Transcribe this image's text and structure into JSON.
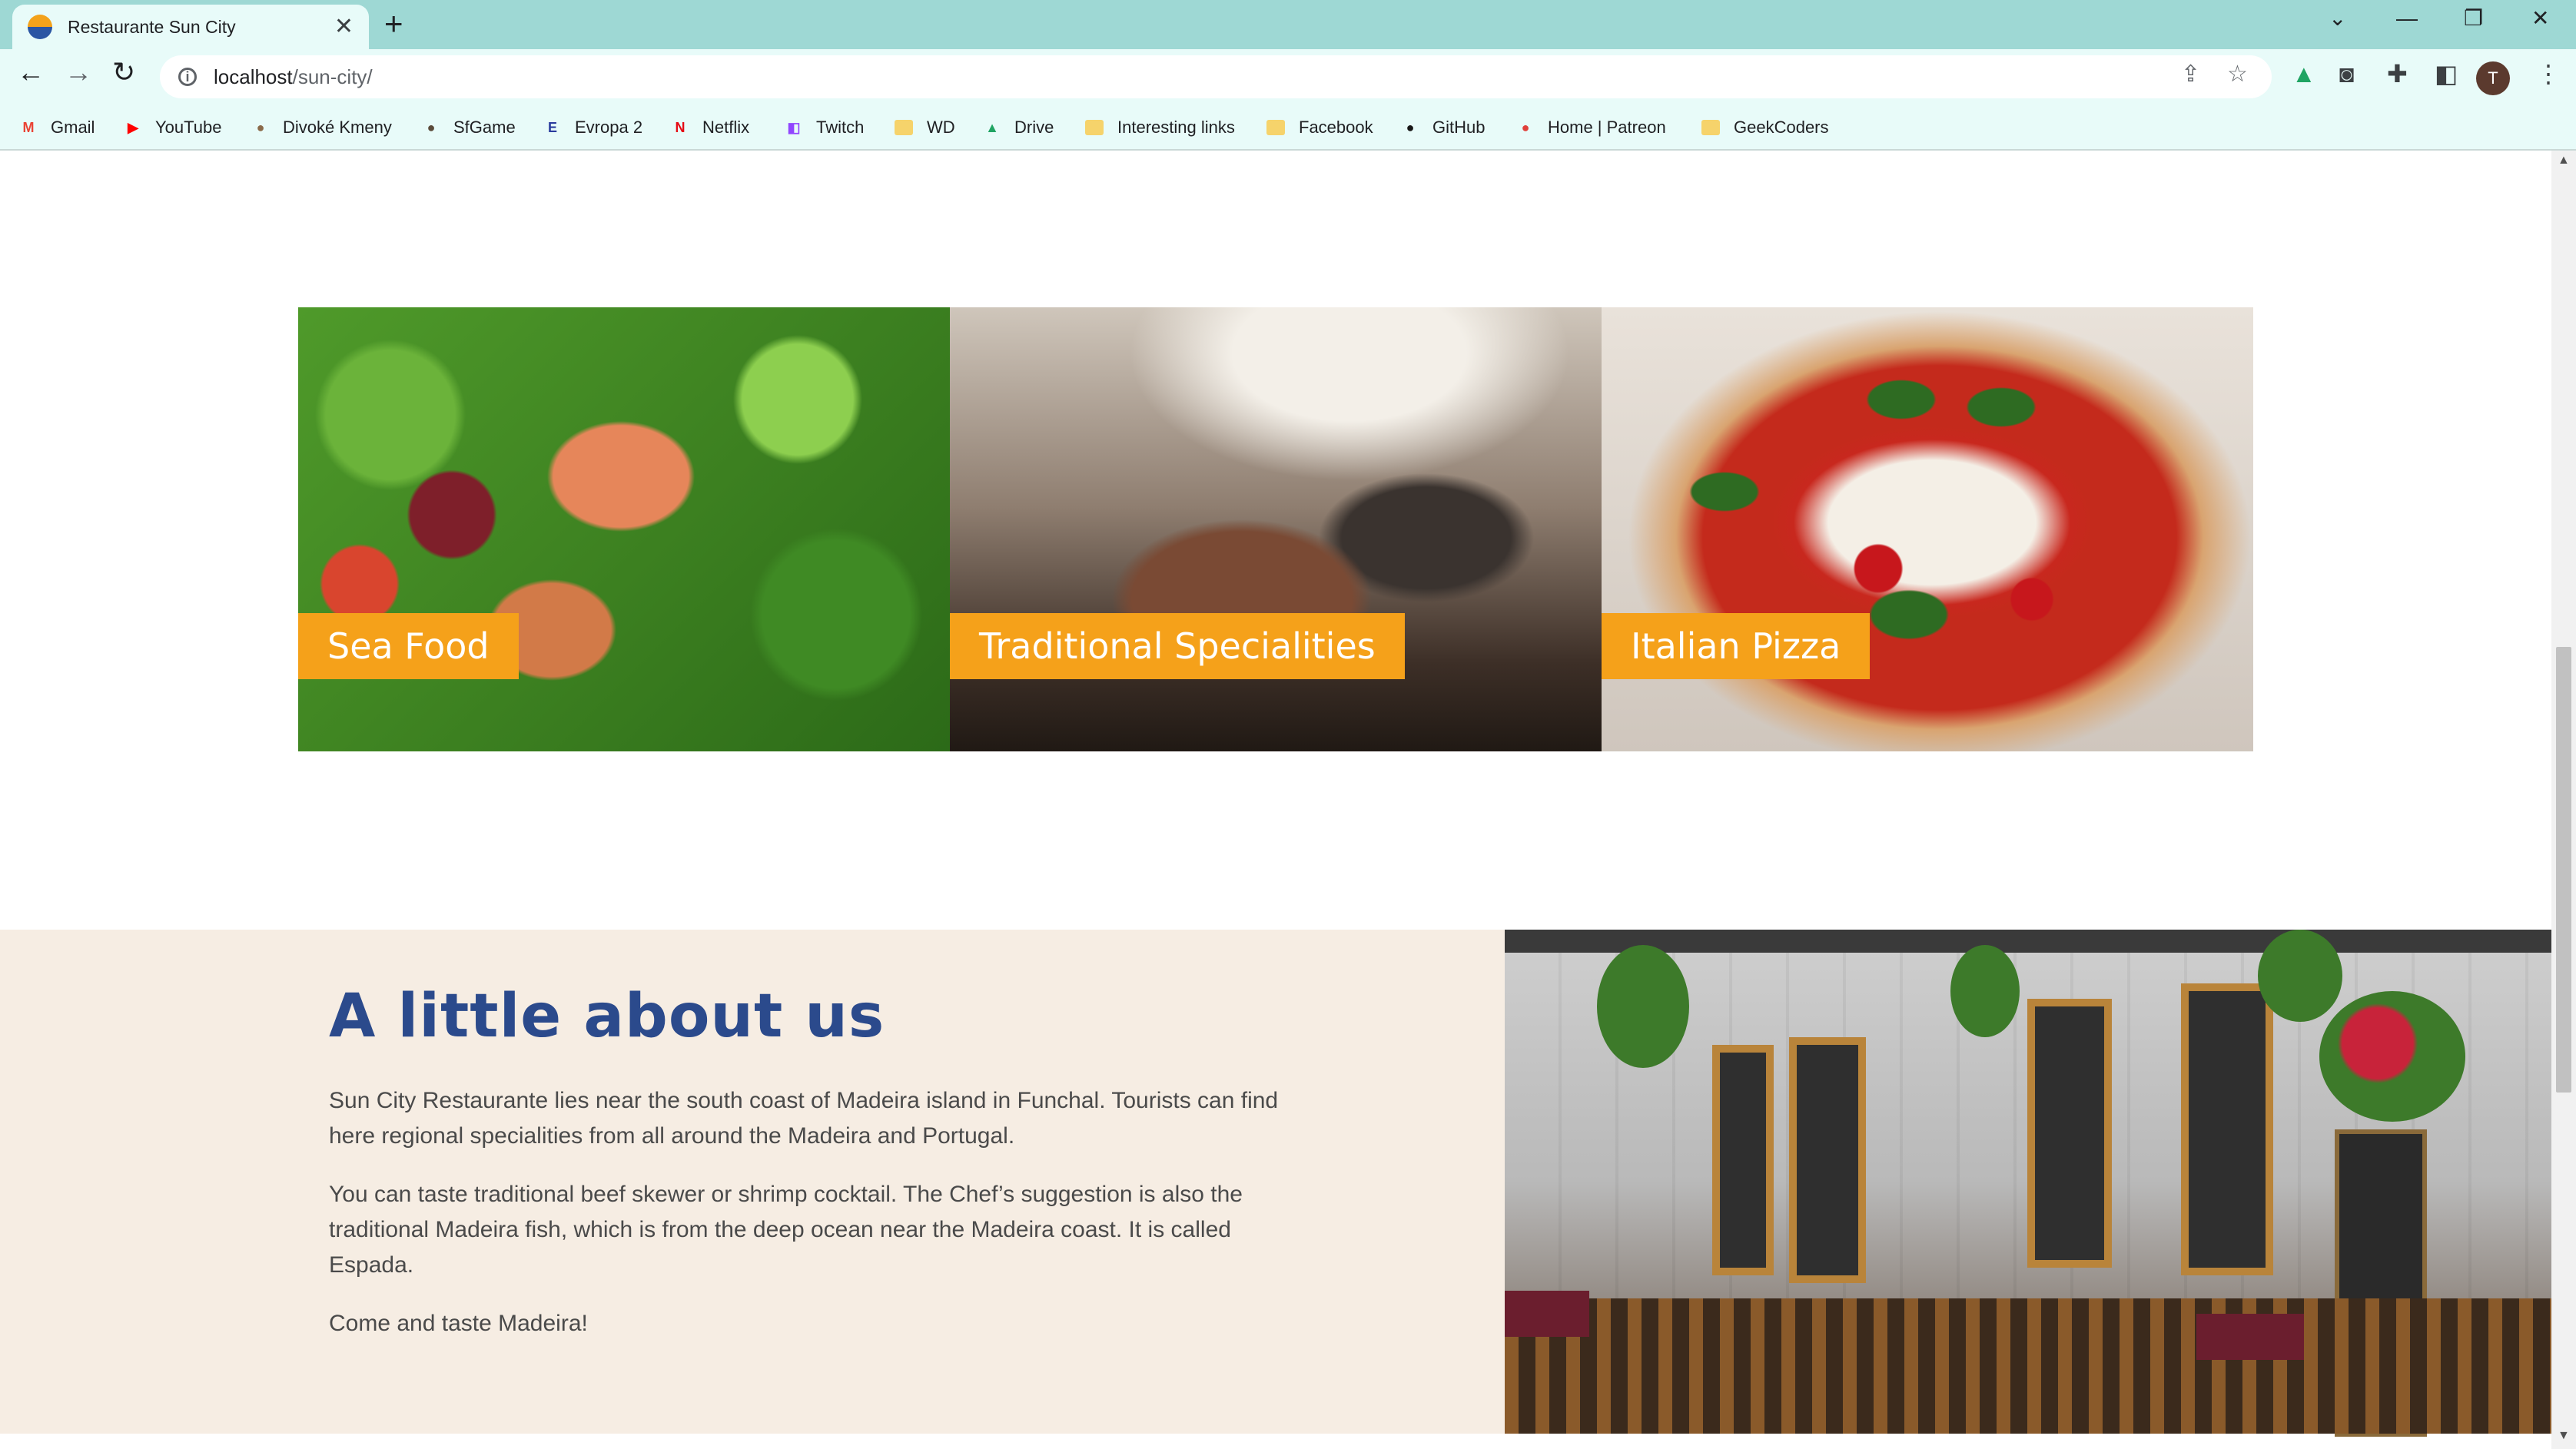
{
  "browser": {
    "tab_title": "Restaurante Sun City",
    "tab_close": "✕",
    "new_tab": "+",
    "url_host": "localhost",
    "url_path": "/sun-city/",
    "avatar_letter": "T",
    "bookmarks": [
      {
        "label": "Gmail",
        "icon": "gmail-icon",
        "glyph": "M",
        "color": "#ea4335"
      },
      {
        "label": "YouTube",
        "icon": "youtube-icon",
        "glyph": "▶",
        "color": "#ff0000"
      },
      {
        "label": "Divoké Kmeny",
        "icon": "divoke-kmeny-icon",
        "glyph": "●",
        "color": "#8a6a4a"
      },
      {
        "label": "SfGame",
        "icon": "sfgame-icon",
        "glyph": "●",
        "color": "#5a4a3a"
      },
      {
        "label": "Evropa 2",
        "icon": "evropa2-icon",
        "glyph": "E",
        "color": "#2a3c9e"
      },
      {
        "label": "Netflix",
        "icon": "netflix-icon",
        "glyph": "N",
        "color": "#e50914"
      },
      {
        "label": "Twitch",
        "icon": "twitch-icon",
        "glyph": "◧",
        "color": "#9146ff"
      },
      {
        "label": "WD",
        "icon": "folder-icon",
        "glyph": "",
        "color": "#f6d36b"
      },
      {
        "label": "Drive",
        "icon": "drive-icon",
        "glyph": "▲",
        "color": "#1fa463"
      },
      {
        "label": "Interesting links",
        "icon": "folder-icon",
        "glyph": "",
        "color": "#f6d36b"
      },
      {
        "label": "Facebook",
        "icon": "folder-icon",
        "glyph": "",
        "color": "#f6d36b"
      },
      {
        "label": "GitHub",
        "icon": "github-icon",
        "glyph": "●",
        "color": "#181717"
      },
      {
        "label": "Home | Patreon",
        "icon": "patreon-icon",
        "glyph": "●",
        "color": "#e0403a"
      },
      {
        "label": "GeekCoders",
        "icon": "folder-icon",
        "glyph": "",
        "color": "#f6d36b"
      }
    ]
  },
  "specials": [
    {
      "label": "Sea Food"
    },
    {
      "label": "Traditional Specialities"
    },
    {
      "label": "Italian Pizza"
    }
  ],
  "about": {
    "title": "A little about us",
    "paragraphs": [
      "Sun City Restaurante lies near the south coast of Madeira island in Funchal. Tourists can find here regional specialities from all around the Madeira and Portugal.",
      "You can taste traditional beef skewer or shrimp cocktail. The Chef’s suggestion is also the traditional Madeira fish, which is from the deep ocean near the Madeira coast. It is called Espada.",
      "Come and taste Madeira!"
    ]
  },
  "colors": {
    "accent": "#f5a11a",
    "heading": "#2b4a8c",
    "about_bg": "#f6ede3",
    "tabstrip": "#9ed8d4"
  }
}
